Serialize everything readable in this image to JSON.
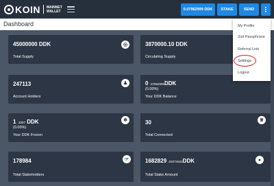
{
  "topbar": {
    "logo_text": "KOIN",
    "logo_sub_line1": "MAINNET",
    "logo_sub_line2": "WALLET",
    "balance_button": "0.07962999 DDK",
    "stake_button": "STAKE",
    "send_button": "SEND"
  },
  "header": {
    "title": "Dashboard"
  },
  "menu": {
    "items": [
      "My Profile",
      "2nd Passphrase",
      "Referral Link",
      "Settings",
      "Logout"
    ]
  },
  "cards": [
    {
      "value": "45000000 DDK",
      "label": "Total Supply",
      "icon": "coin-stack-icon"
    },
    {
      "value": "3870000.10 DDK",
      "label": "Circulating Supply",
      "icon": "coin-stack-icon"
    },
    {
      "value": "247113",
      "label": "Account Holders",
      "icon": "users-icon"
    },
    {
      "value_main": "0",
      "value_small": ".07962999",
      "value_unit": "DDK",
      "percent": "(0.00%)",
      "label": "Your DDK Balance",
      "icon": "wallet-icon"
    },
    {
      "value_main": "1",
      "value_small": ".3267",
      "value_unit": "DDK",
      "percent": "(0.00%)",
      "label": "Your DDK Frozen",
      "icon": "snowflake-icon"
    },
    {
      "value": "30",
      "label": "Total Connected",
      "icon": "crown-icon"
    },
    {
      "value": "178984",
      "label": "Total Stakeholders",
      "icon": "handshake-icon"
    },
    {
      "value_main": "1682829",
      "value_small": ".02074933",
      "value_unit": "DDK",
      "label": "Total Stake Amount",
      "icon": "lock-icon"
    }
  ],
  "colors": {
    "accent": "#1e88e5",
    "topbar": "#26303c",
    "background": "#4b5666",
    "card": "#2d3644",
    "highlight": "#d62020"
  }
}
